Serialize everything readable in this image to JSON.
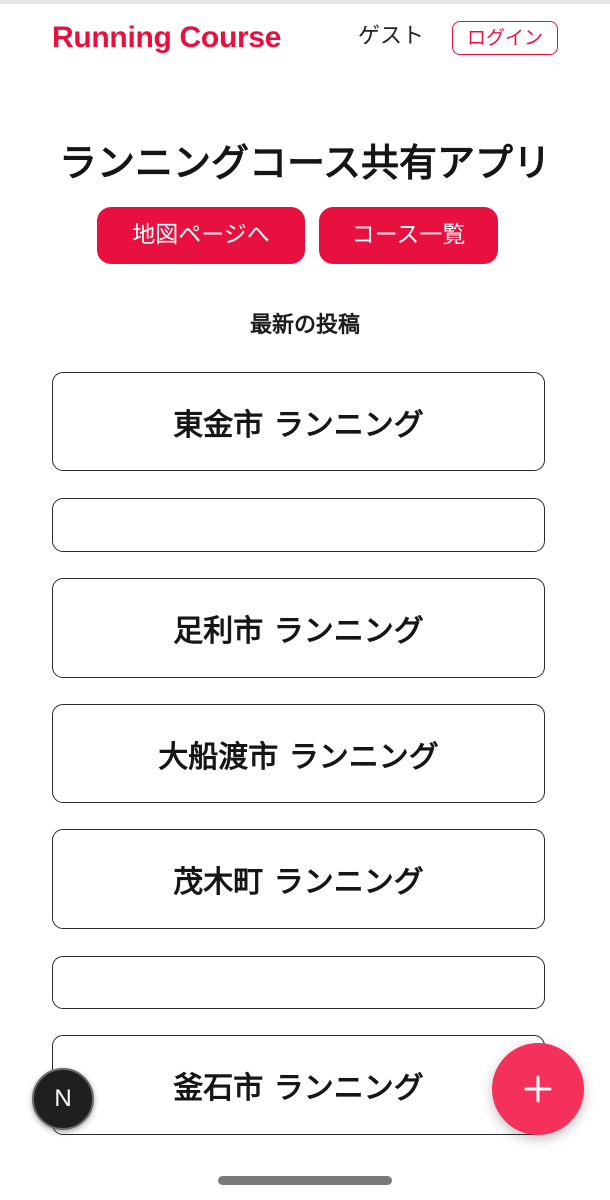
{
  "colors": {
    "accent": "#e8103f",
    "fab": "#f5305a",
    "text": "#1a1a1a",
    "card_border": "#2b2b2b"
  },
  "header": {
    "brand": "Running Course",
    "user": "ゲスト",
    "login_label": "ログイン"
  },
  "main": {
    "title": "ランニングコース共有アプリ",
    "map_button": "地図ページへ",
    "course_list_button": "コース一覧",
    "latest_heading": "最新の投稿"
  },
  "posts": [
    {
      "title": "東金市 ランニング"
    },
    {
      "title": ""
    },
    {
      "title": "足利市 ランニング"
    },
    {
      "title": "大船渡市 ランニング"
    },
    {
      "title": "茂木町 ランニング"
    },
    {
      "title": ""
    },
    {
      "title": "釜石市 ランニング"
    }
  ],
  "overlay": {
    "dev_badge_letter": "N",
    "fab_icon": "plus-icon"
  }
}
